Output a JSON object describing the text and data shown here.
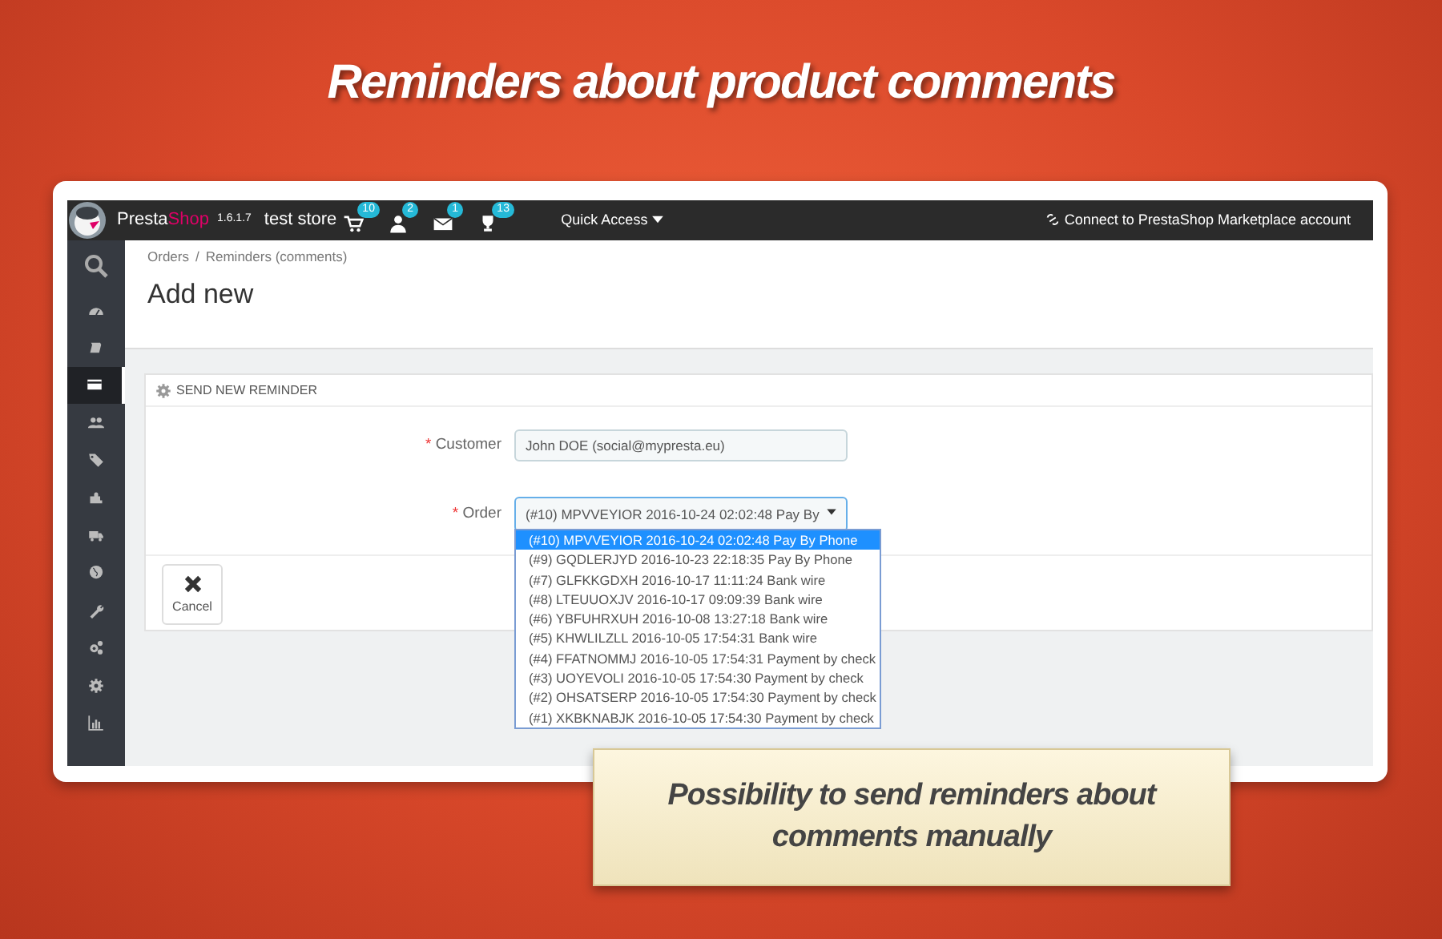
{
  "headline": "Reminders about product comments",
  "topbar": {
    "brand": {
      "first": "Presta",
      "second": "Shop"
    },
    "version": "1.6.1.7",
    "store": "test store",
    "notifications": [
      {
        "count": "10"
      },
      {
        "count": "2"
      },
      {
        "count": "1"
      },
      {
        "count": "13"
      }
    ],
    "quick_access": "Quick Access",
    "connect": "Connect to PrestaShop Marketplace account"
  },
  "sidebar": {
    "items": [
      {
        "selected": false
      },
      {
        "selected": false
      },
      {
        "selected": false
      },
      {
        "selected": true
      },
      {
        "selected": false
      },
      {
        "selected": false
      },
      {
        "selected": false
      },
      {
        "selected": false
      },
      {
        "selected": false
      },
      {
        "selected": false
      },
      {
        "selected": false
      },
      {
        "selected": false
      },
      {
        "selected": false
      }
    ]
  },
  "breadcrumb": [
    "Orders",
    "Reminders (comments)"
  ],
  "breadcrumb_separator": "/",
  "page_title": "Add new",
  "panel": {
    "title": "SEND NEW REMINDER",
    "required_mark": "*",
    "fields": [
      {
        "label": "Customer",
        "required": true,
        "kind": "text",
        "value": "John DOE (social@mypresta.eu)"
      },
      {
        "label": "Order",
        "required": true,
        "kind": "select",
        "value": "(#10) MPVVEYIOR 2016-10-24 02:02:48 Pay By",
        "expanded": true,
        "options": [
          {
            "text": "(#10) MPVVEYIOR 2016-10-24 02:02:48 Pay By Phone",
            "selected": true
          },
          {
            "text": "(#9) GQDLERJYD 2016-10-23 22:18:35 Pay By Phone",
            "selected": false
          },
          {
            "text": "(#7) GLFKKGDXH 2016-10-17 11:11:24 Bank wire",
            "selected": false
          },
          {
            "text": "(#8) LTEUUOXJV 2016-10-17 09:09:39 Bank wire",
            "selected": false
          },
          {
            "text": "(#6) YBFUHRXUH 2016-10-08 13:27:18 Bank wire",
            "selected": false
          },
          {
            "text": "(#5) KHWLILZLL 2016-10-05 17:54:31 Bank wire",
            "selected": false
          },
          {
            "text": "(#4) FFATNOMMJ 2016-10-05 17:54:31 Payment by check",
            "selected": false
          },
          {
            "text": "(#3) UOYEVOLI 2016-10-05 17:54:30 Payment by check",
            "selected": false
          },
          {
            "text": "(#2) OHSATSERP 2016-10-05 17:54:30 Payment by check",
            "selected": false
          },
          {
            "text": "(#1) XKBKNABJK 2016-10-05 17:54:30 Payment by check",
            "selected": false
          }
        ]
      }
    ],
    "cancel": "Cancel"
  },
  "callout": "Possibility to send reminders about comments manually"
}
